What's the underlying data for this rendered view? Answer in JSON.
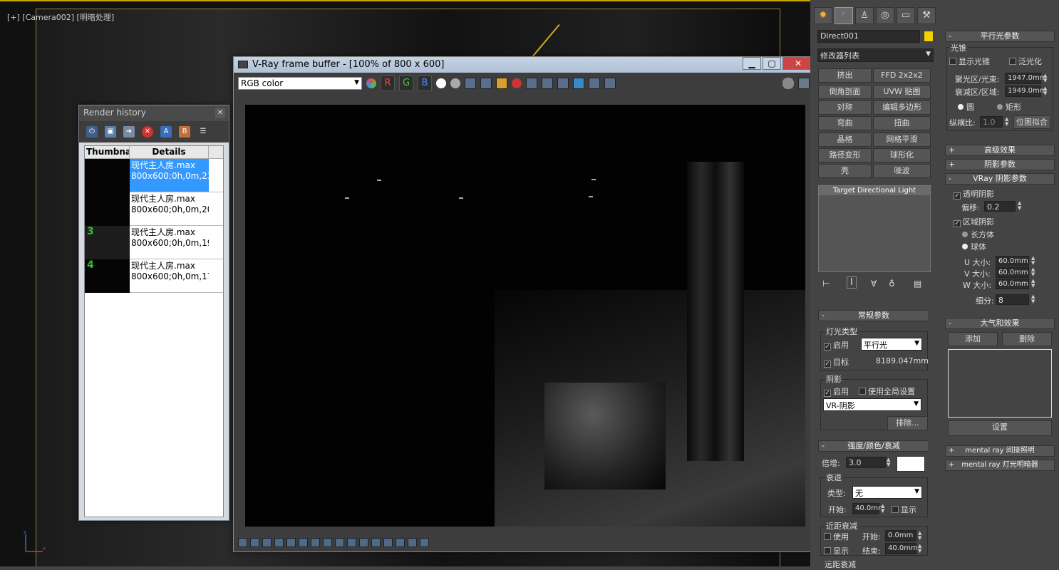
{
  "viewport": {
    "label": "[+] [Camera002] [明暗处理]"
  },
  "render_history": {
    "title": "Render history",
    "columns": [
      "Thumbnai",
      "Details"
    ],
    "rows": [
      {
        "num": "",
        "line1": "现代主人房.max",
        "line2": "800x600;0h,0m,23."
      },
      {
        "num": "",
        "line1": "现代主人房.max",
        "line2": "800x600;0h,0m,20.!"
      },
      {
        "num": "3",
        "line1": "现代主人房.max",
        "line2": "800x600;0h,0m,19.t"
      },
      {
        "num": "4",
        "line1": "现代主人房.max",
        "line2": "800x600;0h,0m,17."
      }
    ]
  },
  "vfb": {
    "title": "V-Ray frame buffer - [100% of 800 x 600]",
    "channel": "RGB color",
    "r": "R",
    "g": "G",
    "b": "B"
  },
  "panel": {
    "object_name": "Direct001",
    "modifier_list": "修改器列表",
    "modifiers": [
      "挤出",
      "FFD 2x2x2",
      "倒角剖面",
      "UVW 贴图",
      "对称",
      "编辑多边形",
      "弯曲",
      "扭曲",
      "晶格",
      "网格平滑",
      "路径变形",
      "球形化",
      "壳",
      "噪波"
    ],
    "stack_item": "Target Directional Light",
    "general": {
      "header": "常规参数",
      "light_type": "灯光类型",
      "enable": "启用",
      "type_value": "平行光",
      "target": "目标",
      "target_dist": "8189.047mm",
      "shadows": "阴影",
      "shadow_enable": "启用",
      "use_global": "使用全局设置",
      "shadow_type": "VR-阴影",
      "exclude": "排除..."
    },
    "intensity": {
      "header": "强度/颜色/衰减",
      "multiplier_label": "倍增:",
      "multiplier": "3.0",
      "decay": "衰退",
      "type_label": "类型:",
      "type_value": "无",
      "start_label": "开始:",
      "start": "40.0mr",
      "show": "显示",
      "near": "近距衰减",
      "use": "使用",
      "near_start_label": "开始:",
      "near_start": "0.0mm",
      "near_show": "显示",
      "end_label": "结束:",
      "end": "40.0mm",
      "far": "远距衰减"
    },
    "directional": {
      "header": "平行光参数",
      "cone": "光锥",
      "show_cone": "显示光锥",
      "overshoot": "泛光化",
      "hotspot_label": "聚光区/光束:",
      "hotspot": "1947.0mm",
      "falloff_label": "衰减区/区域:",
      "falloff": "1949.0mm",
      "circle": "圆",
      "rect": "矩形",
      "aspect_label": "纵横比:",
      "aspect": "1.0",
      "bitmap_fit": "位图拟合"
    },
    "advanced": "高级效果",
    "shadow_params": "阴影参数",
    "vray_shadow": {
      "header": "VRay 阴影参数",
      "transparent": "透明阴影",
      "bias_label": "偏移:",
      "bias": "0.2",
      "area": "区域阴影",
      "box": "长方体",
      "sphere": "球体",
      "u_label": "U 大小:",
      "u": "60.0mm",
      "v_label": "V 大小:",
      "v": "60.0mm",
      "w_label": "W 大小:",
      "w": "60.0mm",
      "subdiv_label": "细分:",
      "subdiv": "8"
    },
    "atmos": {
      "header": "大气和效果",
      "add": "添加",
      "delete": "删除",
      "setup": "设置"
    },
    "mr_indirect": "mental ray 间接照明",
    "mr_shader": "mental ray 灯光明暗器"
  }
}
